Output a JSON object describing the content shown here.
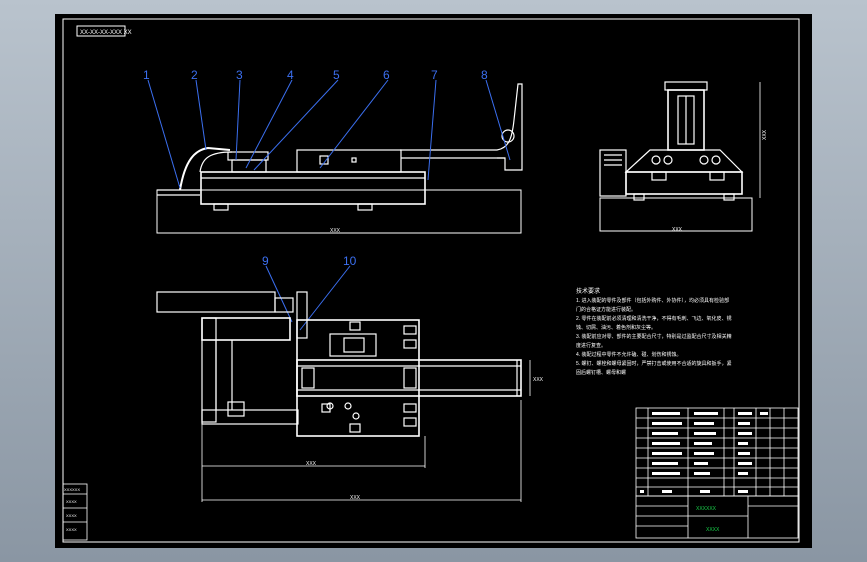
{
  "drawing": {
    "code_label": "XX-XX-XX-XXX XX",
    "balloons": [
      "1",
      "2",
      "3",
      "4",
      "5",
      "6",
      "7",
      "8",
      "9",
      "10"
    ],
    "dims": {
      "front_length": "XXX",
      "side_width": "XXX",
      "side_height": "XXX",
      "plan_inner": "XXX",
      "plan_overall": "XXX",
      "plan_side": "XXX"
    },
    "tech_title": "技术要求",
    "tech_lines": [
      "1. 进入装配的零件及部件（包括外购件、外协件），均必须具有检验部",
      "门的合格证方能进行装配。",
      "2. 零件在装配前必须清理和清洗干净，不得有毛刺、飞边、氧化皮、锈",
      "蚀、切屑、油污、着色剂和灰尘等。",
      "3. 装配前应对零、部件的主要配合尺寸，特别是过盈配合尺寸及相关精",
      "度进行复查。",
      "4. 装配过程中零件不允许磕、碰、划伤和锈蚀。",
      "5. 螺钉、螺栓和螺母紧固时，严禁打击或使用不合适的旋具和扳手，紧",
      "固后螺钉槽、螺母和螺"
    ],
    "title_block_name": "XXXXXX",
    "title_block_code": "XXXX",
    "left_stamps": [
      "XXXXXX",
      "XXXX",
      "XXXX",
      "XXXX"
    ]
  }
}
